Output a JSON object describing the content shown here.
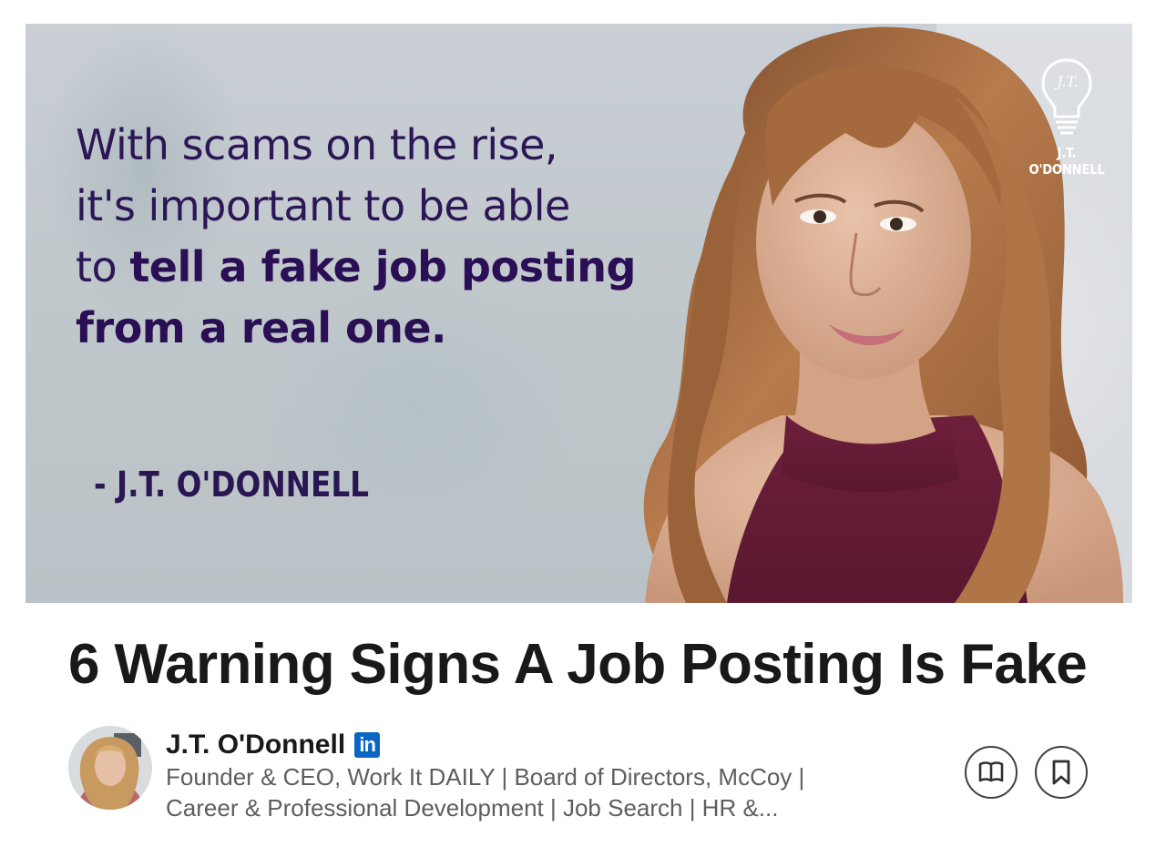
{
  "hero": {
    "quote_line1": "With scams on the rise,",
    "quote_line2": "it's important to be able",
    "quote_line3_plain": "to ",
    "quote_line3_bold": "tell a fake job posting",
    "quote_line4_bold": "from a real one.",
    "attribution": "- J.T. O'DONNELL",
    "logo_text": "J.T. O'DONNELL",
    "logo_initials": "J.T."
  },
  "article": {
    "title": "6 Warning Signs A Job Posting Is Fake"
  },
  "author": {
    "name": "J.T. O'Donnell",
    "badge_text": "in",
    "headline_line1": "Founder & CEO, Work It DAILY | Board of Directors, McCoy |",
    "headline_line2": "Career & Professional Development | Job Search | HR &..."
  },
  "actions": {
    "read_icon": "open-book-icon",
    "save_icon": "bookmark-icon"
  },
  "colors": {
    "quote_purple": "#2c1656",
    "linkedin_blue": "#0a66c2",
    "title_text": "#191919",
    "headline_text": "#5e5e5e"
  }
}
